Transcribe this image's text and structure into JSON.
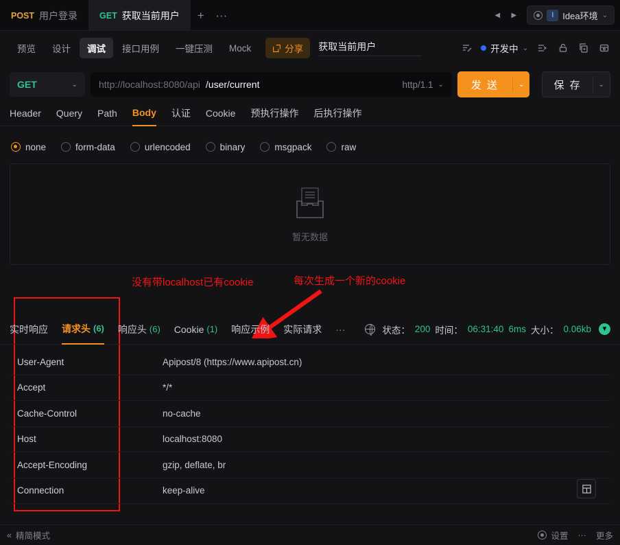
{
  "tabs": {
    "items": [
      {
        "method": "POST",
        "title": "用户登录",
        "active": false
      },
      {
        "method": "GET",
        "title": "获取当前用户",
        "active": true
      }
    ],
    "add_label": "+",
    "more_label": "···",
    "prev_label": "◀",
    "next_label": "▶",
    "environment": {
      "badge": "I",
      "name": "Idea环境",
      "caret": "⌄"
    }
  },
  "subtoolbar": {
    "segments": [
      {
        "label": "预览",
        "active": false
      },
      {
        "label": "设计",
        "active": false
      },
      {
        "label": "调试",
        "active": true
      },
      {
        "label": "接口用例",
        "active": false
      },
      {
        "label": "一键压测",
        "active": false
      },
      {
        "label": "Mock",
        "active": false
      }
    ],
    "share_label": "分享",
    "share_icon": "share-icon",
    "request_name": "获取当前用户",
    "status_label": "开发中",
    "status_color": "#2f6bff",
    "icons": [
      "sort-lines-icon",
      "indent-icon",
      "lock-icon",
      "copy-add-icon",
      "archive-icon"
    ]
  },
  "urlbar": {
    "method": "GET",
    "method_caret": "⌄",
    "url_prefix": "http://localhost:8080/api",
    "url_path": "/user/current",
    "protocol": "http/1.1",
    "protocol_caret": "⌄",
    "send_label": "发 送",
    "send_caret": "⌄",
    "save_label": "保 存",
    "save_caret": "⌄"
  },
  "param_tabs": [
    {
      "label": "Header",
      "active": false
    },
    {
      "label": "Query",
      "active": false
    },
    {
      "label": "Path",
      "active": false
    },
    {
      "label": "Body",
      "active": true
    },
    {
      "label": "认证",
      "active": false
    },
    {
      "label": "Cookie",
      "active": false
    },
    {
      "label": "预执行操作",
      "active": false
    },
    {
      "label": "后执行操作",
      "active": false
    }
  ],
  "body_types": [
    {
      "label": "none",
      "selected": true
    },
    {
      "label": "form-data",
      "selected": false
    },
    {
      "label": "urlencoded",
      "selected": false
    },
    {
      "label": "binary",
      "selected": false
    },
    {
      "label": "msgpack",
      "selected": false
    },
    {
      "label": "raw",
      "selected": false
    }
  ],
  "empty_state": {
    "text": "暂无数据",
    "icon": "empty-inbox-icon"
  },
  "annotations": {
    "color": "#f01414",
    "left_note": "没有带localhost已有cookie",
    "right_note": "每次生成一个新的cookie",
    "arrow": "arrow-pointing-down-left"
  },
  "response": {
    "tabs": [
      {
        "label": "实时响应",
        "count": "",
        "active": false
      },
      {
        "label": "请求头",
        "count": "(6)",
        "active": true
      },
      {
        "label": "响应头",
        "count": "(6)",
        "active": false
      },
      {
        "label": "Cookie",
        "count": "(1)",
        "active": false
      },
      {
        "label": "响应示例",
        "count": "",
        "active": false
      },
      {
        "label": "实际请求",
        "count": "",
        "active": false
      }
    ],
    "more_label": "···",
    "globe_icon": "globe-icon",
    "meta": {
      "status_label": "状态：",
      "status_value": "200",
      "time_label": "时间：",
      "time_value": "06:31:40",
      "duration_value": "6ms",
      "size_label": "大小：",
      "size_value": "0.06kb"
    },
    "download_icon": "download-icon",
    "grid_icon": "layout-grid-icon",
    "headers": [
      {
        "key": "User-Agent",
        "value": "Apipost/8 (https://www.apipost.cn)"
      },
      {
        "key": "Accept",
        "value": "*/*"
      },
      {
        "key": "Cache-Control",
        "value": "no-cache"
      },
      {
        "key": "Host",
        "value": "localhost:8080"
      },
      {
        "key": "Accept-Encoding",
        "value": "gzip, deflate, br"
      },
      {
        "key": "Connection",
        "value": "keep-alive"
      }
    ]
  },
  "statusbar": {
    "collapse_icon": "double-chevron-left-icon",
    "mode_label": "精简模式",
    "settings_icon": "gear-icon",
    "settings_label": "设置",
    "more_label": "···",
    "right_label": "更多"
  }
}
